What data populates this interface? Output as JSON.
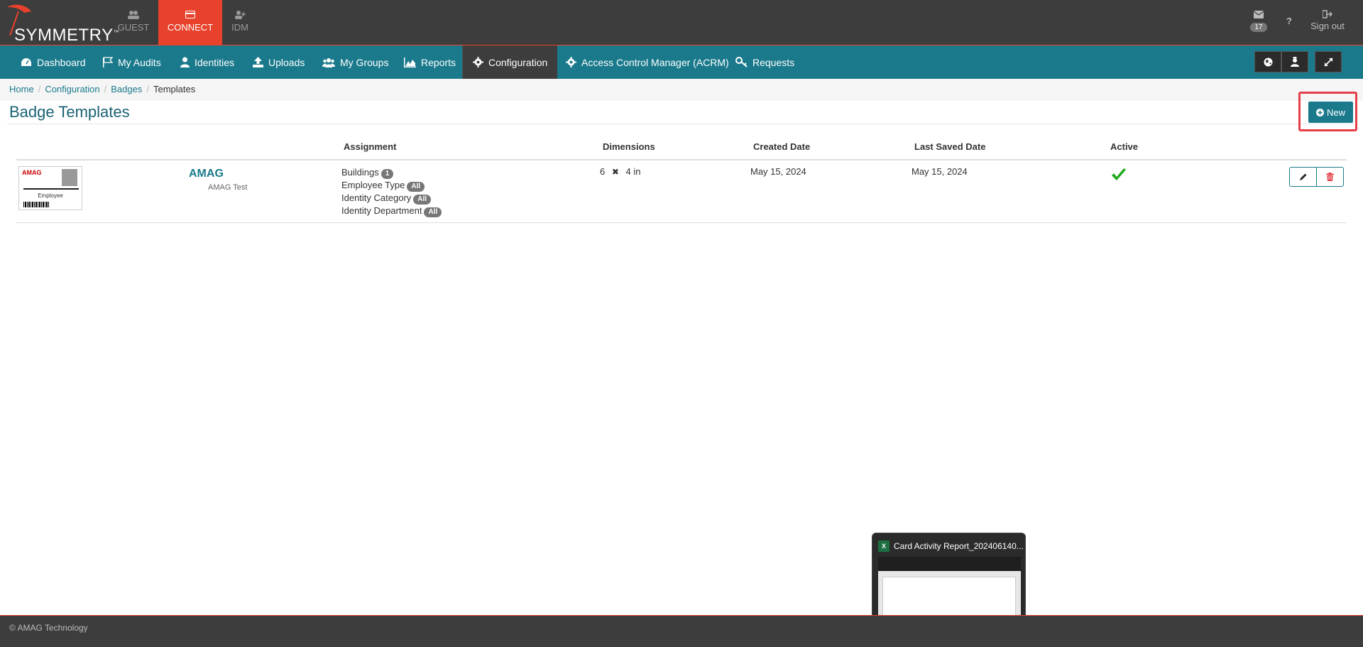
{
  "brand": {
    "name": "SYMMETRY",
    "tm": "™",
    "accent": "#e8412c",
    "teal": "#1a7a8c"
  },
  "app_tabs": [
    {
      "label": "GUEST"
    },
    {
      "label": "CONNECT"
    },
    {
      "label": "IDM"
    }
  ],
  "top_right": {
    "mail_count": "17",
    "help": "?",
    "sign_out": "Sign out"
  },
  "nav": {
    "items": [
      {
        "label": "Dashboard",
        "icon": "dashboard-icon"
      },
      {
        "label": "My Audits",
        "icon": "flag-icon"
      },
      {
        "label": "Identities",
        "icon": "user-icon"
      },
      {
        "label": "Uploads",
        "icon": "upload-icon"
      },
      {
        "label": "My Groups",
        "icon": "group-icon"
      },
      {
        "label": "Reports",
        "icon": "area-chart-icon"
      },
      {
        "label": "Configuration",
        "icon": "gear-icon"
      },
      {
        "label": "Access Control Manager (ACRM)",
        "icon": "gear-icon"
      },
      {
        "label": "Requests",
        "icon": "key-icon"
      }
    ]
  },
  "breadcrumb": {
    "home": "Home",
    "configuration": "Configuration",
    "badges": "Badges",
    "current": "Templates"
  },
  "page": {
    "title": "Badge Templates",
    "new_button": "New"
  },
  "table": {
    "headers": {
      "assignment": "Assignment",
      "dimensions": "Dimensions",
      "created": "Created Date",
      "saved": "Last Saved Date",
      "active": "Active"
    },
    "rows": [
      {
        "name": "AMAG",
        "description": "AMAG Test",
        "thumb_logo": "AMAG",
        "thumb_label": "Employee",
        "assign": [
          {
            "label": "Buildings",
            "pill": "1"
          },
          {
            "label": "Employee Type",
            "pill": "All"
          },
          {
            "label": "Identity Category",
            "pill": "All"
          },
          {
            "label": "Identity Department",
            "pill": "All"
          }
        ],
        "dim_w": "6",
        "dim_x": "✖",
        "dim_h": "4 in",
        "created": "May 15, 2024",
        "saved": "May 15, 2024",
        "active": true
      }
    ]
  },
  "taskbar_preview": {
    "title": "Card Activity Report_202406140..."
  },
  "footer": {
    "text": "© AMAG Technology"
  }
}
